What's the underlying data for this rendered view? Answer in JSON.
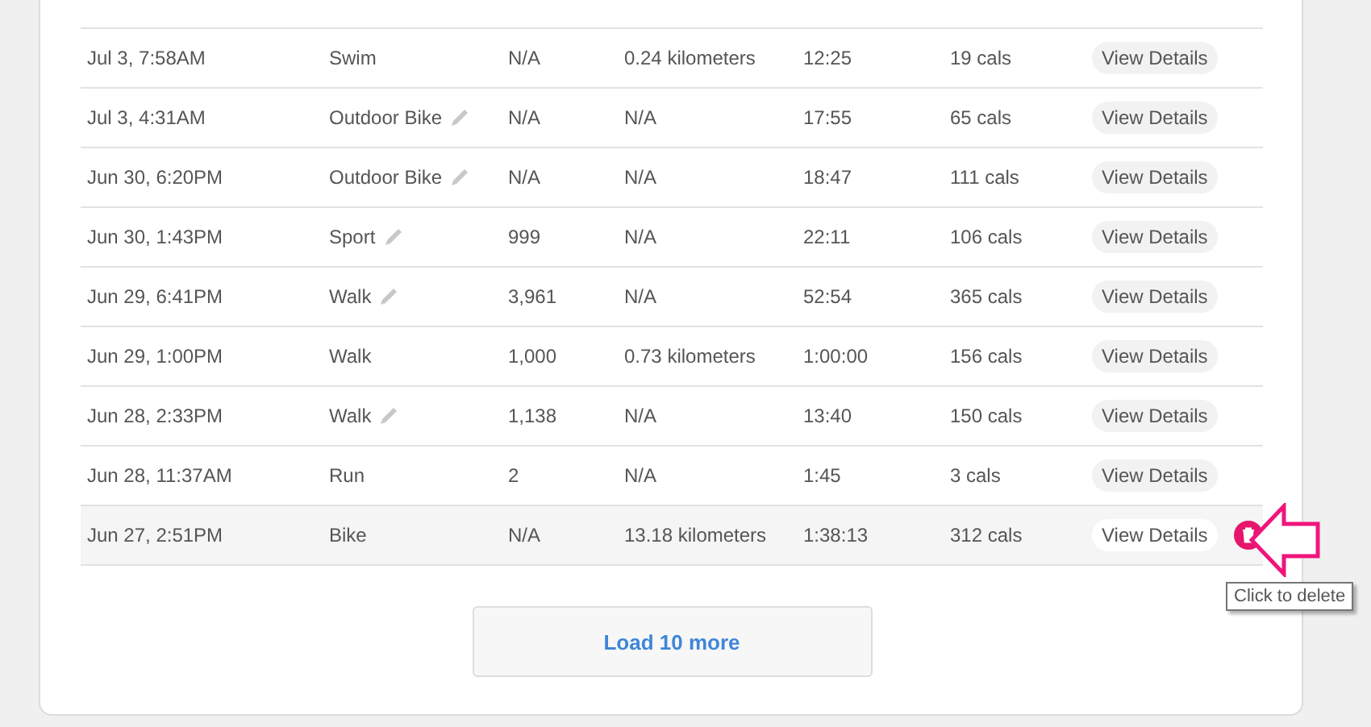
{
  "rows": [
    {
      "date": "Jul 3, 7:58AM",
      "type": "Swim",
      "editable": false,
      "steps": "N/A",
      "distance": "0.24 kilometers",
      "duration": "12:25",
      "calories": "19 cals",
      "action": "View Details",
      "highlighted": false
    },
    {
      "date": "Jul 3, 4:31AM",
      "type": "Outdoor Bike",
      "editable": true,
      "steps": "N/A",
      "distance": "N/A",
      "duration": "17:55",
      "calories": "65 cals",
      "action": "View Details",
      "highlighted": false
    },
    {
      "date": "Jun 30, 6:20PM",
      "type": "Outdoor Bike",
      "editable": true,
      "steps": "N/A",
      "distance": "N/A",
      "duration": "18:47",
      "calories": "111 cals",
      "action": "View Details",
      "highlighted": false
    },
    {
      "date": "Jun 30, 1:43PM",
      "type": "Sport",
      "editable": true,
      "steps": "999",
      "distance": "N/A",
      "duration": "22:11",
      "calories": "106 cals",
      "action": "View Details",
      "highlighted": false
    },
    {
      "date": "Jun 29, 6:41PM",
      "type": "Walk",
      "editable": true,
      "steps": "3,961",
      "distance": "N/A",
      "duration": "52:54",
      "calories": "365 cals",
      "action": "View Details",
      "highlighted": false
    },
    {
      "date": "Jun 29, 1:00PM",
      "type": "Walk",
      "editable": false,
      "steps": "1,000",
      "distance": "0.73 kilometers",
      "duration": "1:00:00",
      "calories": "156 cals",
      "action": "View Details",
      "highlighted": false
    },
    {
      "date": "Jun 28, 2:33PM",
      "type": "Walk",
      "editable": true,
      "steps": "1,138",
      "distance": "N/A",
      "duration": "13:40",
      "calories": "150 cals",
      "action": "View Details",
      "highlighted": false
    },
    {
      "date": "Jun 28, 11:37AM",
      "type": "Run",
      "editable": false,
      "steps": "2",
      "distance": "N/A",
      "duration": "1:45",
      "calories": "3 cals",
      "action": "View Details",
      "highlighted": false
    },
    {
      "date": "Jun 27, 2:51PM",
      "type": "Bike",
      "editable": false,
      "steps": "N/A",
      "distance": "13.18 kilometers",
      "duration": "1:38:13",
      "calories": "312 cals",
      "action": "View Details",
      "highlighted": true
    }
  ],
  "tooltip": "Click to delete",
  "load_more": "Load 10 more"
}
